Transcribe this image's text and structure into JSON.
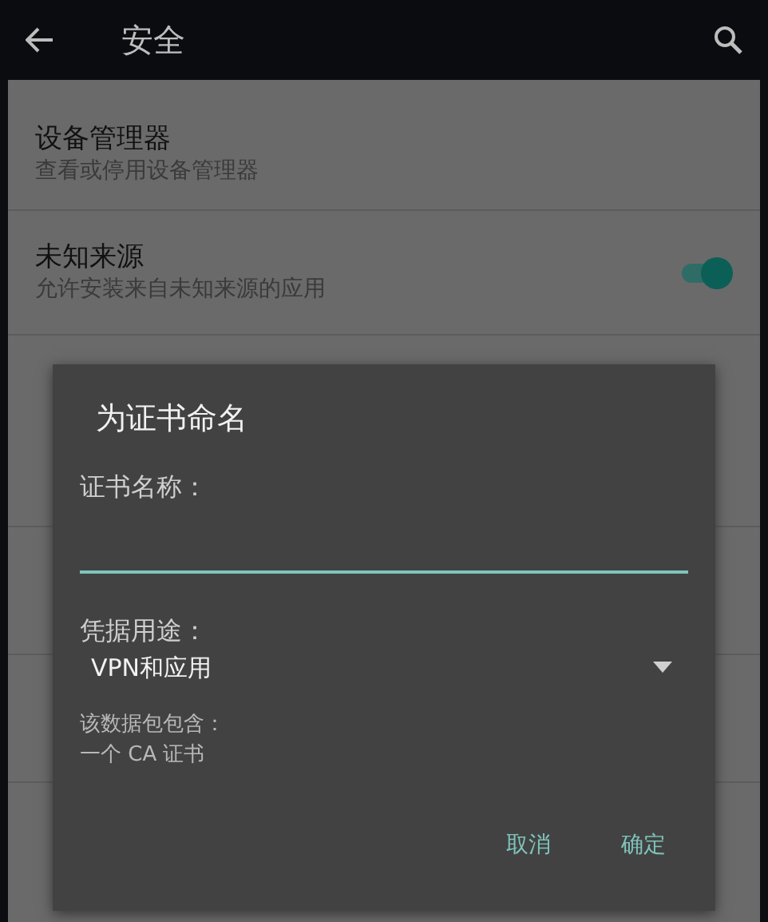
{
  "app_bar": {
    "title": "安全"
  },
  "settings": [
    {
      "kind": "item",
      "title": "设备管理器",
      "summary": "查看或停用设备管理器"
    },
    {
      "kind": "switch",
      "title": "未知来源",
      "summary": "允许安装来自未知来源的应用",
      "on": true
    },
    {
      "kind": "header"
    },
    {
      "kind": "covered"
    },
    {
      "kind": "covered"
    },
    {
      "kind": "covered"
    },
    {
      "kind": "covered"
    }
  ],
  "dialog": {
    "title": "为证书命名",
    "name_label": "证书名称：",
    "usage_label": "凭据用途：",
    "usage_value": "VPN和应用",
    "contents_label": "该数据包包含：",
    "contents_value": "一个 CA 证书",
    "buttons": [
      "取消",
      "确定"
    ]
  }
}
